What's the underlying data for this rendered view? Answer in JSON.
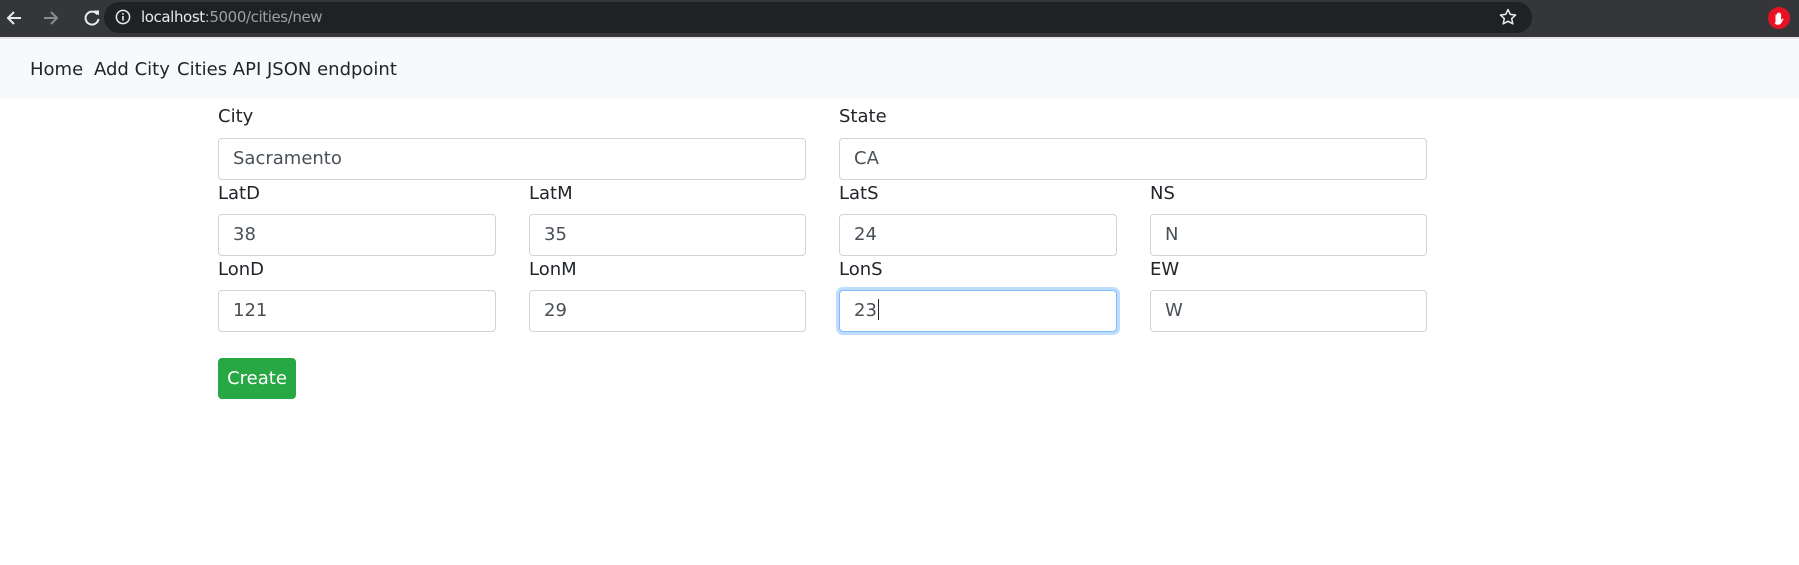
{
  "browser": {
    "url_host": "localhost",
    "url_path": ":5000/cities/new",
    "icons": {
      "back": "back-arrow-icon",
      "forward": "forward-arrow-icon",
      "reload": "reload-icon",
      "info": "info-icon",
      "bookmark": "star-icon",
      "extension": "hand-stop-icon"
    },
    "colors": {
      "toolbar": "#35363a",
      "omnibox": "#202124",
      "extension": "#e81123"
    }
  },
  "navbar": {
    "links": [
      {
        "label": "Home"
      },
      {
        "label": "Add City"
      },
      {
        "label": "Cities API JSON endpoint"
      }
    ]
  },
  "form": {
    "fields": {
      "city": {
        "label": "City",
        "value": "Sacramento"
      },
      "state": {
        "label": "State",
        "value": "CA"
      },
      "latd": {
        "label": "LatD",
        "value": "38"
      },
      "latm": {
        "label": "LatM",
        "value": "35"
      },
      "lats": {
        "label": "LatS",
        "value": "24"
      },
      "ns": {
        "label": "NS",
        "value": "N"
      },
      "lond": {
        "label": "LonD",
        "value": "121"
      },
      "lonm": {
        "label": "LonM",
        "value": "29"
      },
      "lons": {
        "label": "LonS",
        "value": "23",
        "focused": true
      },
      "ew": {
        "label": "EW",
        "value": "W"
      }
    },
    "submit_label": "Create",
    "colors": {
      "submit": "#28a745",
      "focus": "#80bdff"
    }
  }
}
